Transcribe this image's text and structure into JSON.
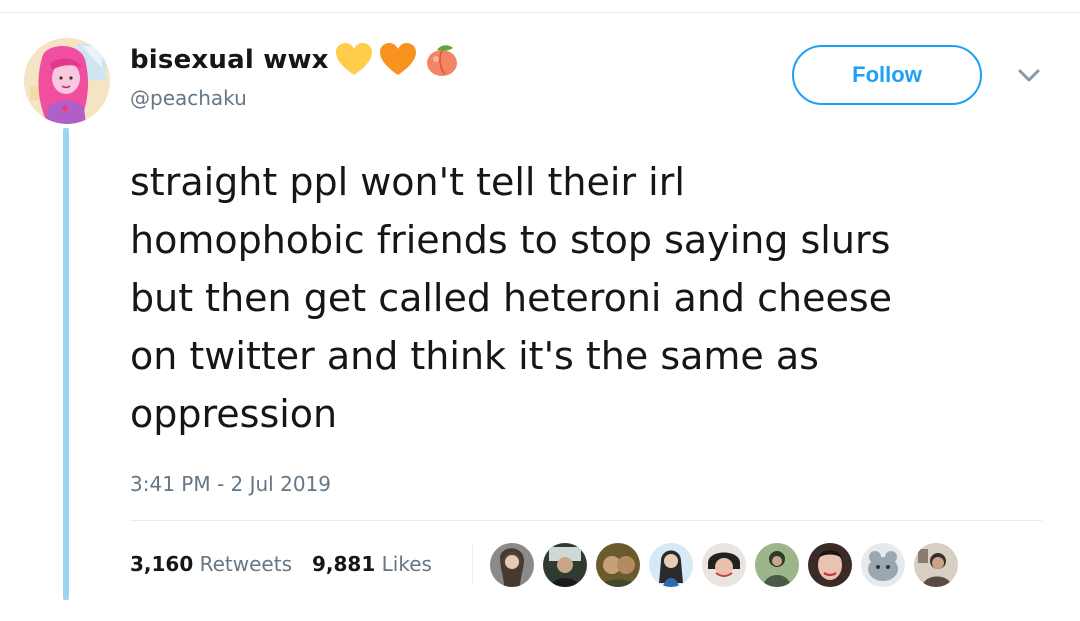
{
  "user": {
    "display_name": "bisexual wwx",
    "handle": "@peachaku",
    "name_emojis": [
      "yellow-heart-icon",
      "orange-heart-icon",
      "peach-icon"
    ]
  },
  "header": {
    "follow_label": "Follow"
  },
  "tweet": {
    "text": "straight ppl won't tell their irl\nhomophobic friends to stop saying slurs\nbut then get called heteroni and cheese\non twitter and think it's the same as\noppression",
    "timestamp": "3:41 PM - 2 Jul 2019"
  },
  "stats": {
    "retweets_count": "3,160",
    "retweets_label": "Retweets",
    "likes_count": "9,881",
    "likes_label": "Likes"
  },
  "likers": [
    "liker-avatar-1",
    "liker-avatar-2",
    "liker-avatar-3",
    "liker-avatar-4",
    "liker-avatar-5",
    "liker-avatar-6",
    "liker-avatar-7",
    "liker-avatar-8",
    "liker-avatar-9"
  ],
  "colors": {
    "accent": "#1da1f2",
    "thread_line": "#9fd4f0",
    "secondary_text": "#657786",
    "primary_text": "#14171a"
  }
}
